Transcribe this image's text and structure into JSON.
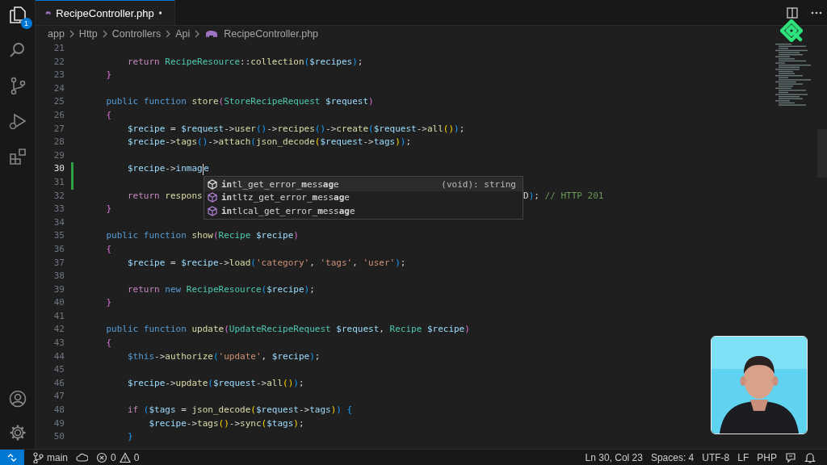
{
  "activity_bar": {
    "items": [
      {
        "selected": true,
        "badge": "1"
      },
      {
        "selected": false
      },
      {
        "selected": false
      },
      {
        "selected": false
      },
      {
        "selected": false
      }
    ]
  },
  "tabs": [
    {
      "label": "RecipeController.php",
      "selected": true,
      "modified": true
    }
  ],
  "breadcrumbs": [
    {
      "label": "app"
    },
    {
      "label": "Http"
    },
    {
      "label": "Controllers"
    },
    {
      "label": "Api"
    },
    {
      "label": "RecipeController.php"
    }
  ],
  "editor": {
    "lines": [
      {
        "number": "21",
        "current": false,
        "modified": false
      },
      {
        "number": "22",
        "current": false,
        "modified": false,
        "tokens": [
          {
            "kind": "kw",
            "text": "        return"
          },
          {
            "kind": "ty",
            "text": " RecipeResource"
          },
          {
            "kind": "pl",
            "text": "::"
          },
          {
            "kind": "fn",
            "text": "collection"
          },
          {
            "kind": "b3",
            "text": "("
          },
          {
            "kind": "var",
            "text": "$recipes"
          },
          {
            "kind": "b3",
            "text": ")"
          },
          {
            "kind": "pl",
            "text": ";"
          }
        ]
      },
      {
        "number": "23",
        "current": false,
        "modified": false,
        "tokens": [
          {
            "kind": "b2",
            "text": "    }"
          }
        ]
      },
      {
        "number": "24",
        "current": false,
        "modified": false
      },
      {
        "number": "25",
        "current": false,
        "modified": false,
        "tokens": [
          {
            "kind": "st",
            "text": "    public function"
          },
          {
            "kind": "fn",
            "text": " store"
          },
          {
            "kind": "b2",
            "text": "("
          },
          {
            "kind": "ty",
            "text": "StoreRecipeRequest"
          },
          {
            "kind": "var",
            "text": " $request"
          },
          {
            "kind": "b2",
            "text": ")"
          }
        ]
      },
      {
        "number": "26",
        "current": false,
        "modified": false,
        "tokens": [
          {
            "kind": "b2",
            "text": "    {"
          }
        ]
      },
      {
        "number": "27",
        "current": false,
        "modified": false,
        "tokens": [
          {
            "kind": "var",
            "text": "        $recipe"
          },
          {
            "kind": "pl",
            "text": " ="
          },
          {
            "kind": "var",
            "text": " $request"
          },
          {
            "kind": "pl",
            "text": "->"
          },
          {
            "kind": "fn",
            "text": "user"
          },
          {
            "kind": "b3",
            "text": "()"
          },
          {
            "kind": "pl",
            "text": "->"
          },
          {
            "kind": "fn",
            "text": "recipes"
          },
          {
            "kind": "b3",
            "text": "()"
          },
          {
            "kind": "pl",
            "text": "->"
          },
          {
            "kind": "fn",
            "text": "create"
          },
          {
            "kind": "b3",
            "text": "("
          },
          {
            "kind": "var",
            "text": "$request"
          },
          {
            "kind": "pl",
            "text": "->"
          },
          {
            "kind": "fn",
            "text": "all"
          },
          {
            "kind": "b1",
            "text": "()"
          },
          {
            "kind": "b3",
            "text": ")"
          },
          {
            "kind": "pl",
            "text": ";"
          }
        ]
      },
      {
        "number": "28",
        "current": false,
        "modified": false,
        "tokens": [
          {
            "kind": "var",
            "text": "        $recipe"
          },
          {
            "kind": "pl",
            "text": "->"
          },
          {
            "kind": "fn",
            "text": "tags"
          },
          {
            "kind": "b3",
            "text": "()"
          },
          {
            "kind": "pl",
            "text": "->"
          },
          {
            "kind": "fn",
            "text": "attach"
          },
          {
            "kind": "b3",
            "text": "("
          },
          {
            "kind": "fn",
            "text": "json_decode"
          },
          {
            "kind": "b1",
            "text": "("
          },
          {
            "kind": "var",
            "text": "$request"
          },
          {
            "kind": "pl",
            "text": "->"
          },
          {
            "kind": "var",
            "text": "tags"
          },
          {
            "kind": "b1",
            "text": ")"
          },
          {
            "kind": "b3",
            "text": ")"
          },
          {
            "kind": "pl",
            "text": ";"
          }
        ]
      },
      {
        "number": "29",
        "current": false,
        "modified": false
      },
      {
        "number": "30",
        "current": true,
        "modified": true,
        "tokens": [
          {
            "kind": "var",
            "text": "        $recipe"
          },
          {
            "kind": "pl",
            "text": "->"
          },
          {
            "kind": "var",
            "text": "inmag"
          },
          {
            "kind": "caret"
          },
          {
            "kind": "var",
            "text": "e"
          }
        ]
      },
      {
        "number": "31",
        "current": false,
        "modified": true
      },
      {
        "number": "32",
        "current": false,
        "modified": false,
        "tokens": [
          {
            "kind": "kw",
            "text": "        return"
          },
          {
            "kind": "fn",
            "text": " respons"
          },
          {
            "kind": "tail",
            "text": "D"
          },
          {
            "kind": "b3",
            "text": ")"
          },
          {
            "kind": "pl",
            "text": ";"
          },
          {
            "kind": "com",
            "text": " // HTTP 201"
          }
        ]
      },
      {
        "number": "33",
        "current": false,
        "modified": false,
        "tokens": [
          {
            "kind": "b2",
            "text": "    }"
          }
        ]
      },
      {
        "number": "34",
        "current": false,
        "modified": false
      },
      {
        "number": "35",
        "current": false,
        "modified": false,
        "tokens": [
          {
            "kind": "st",
            "text": "    public function"
          },
          {
            "kind": "fn",
            "text": " show"
          },
          {
            "kind": "b2",
            "text": "("
          },
          {
            "kind": "ty",
            "text": "Recipe"
          },
          {
            "kind": "var",
            "text": " $recipe"
          },
          {
            "kind": "b2",
            "text": ")"
          }
        ]
      },
      {
        "number": "36",
        "current": false,
        "modified": false,
        "tokens": [
          {
            "kind": "b2",
            "text": "    {"
          }
        ]
      },
      {
        "number": "37",
        "current": false,
        "modified": false,
        "tokens": [
          {
            "kind": "var",
            "text": "        $recipe"
          },
          {
            "kind": "pl",
            "text": " ="
          },
          {
            "kind": "var",
            "text": " $recipe"
          },
          {
            "kind": "pl",
            "text": "->"
          },
          {
            "kind": "fn",
            "text": "load"
          },
          {
            "kind": "b3",
            "text": "("
          },
          {
            "kind": "str",
            "text": "'category'"
          },
          {
            "kind": "pl",
            "text": ","
          },
          {
            "kind": "str",
            "text": " 'tags'"
          },
          {
            "kind": "pl",
            "text": ","
          },
          {
            "kind": "str",
            "text": " 'user'"
          },
          {
            "kind": "b3",
            "text": ")"
          },
          {
            "kind": "pl",
            "text": ";"
          }
        ]
      },
      {
        "number": "38",
        "current": false,
        "modified": false
      },
      {
        "number": "39",
        "current": false,
        "modified": false,
        "tokens": [
          {
            "kind": "kw",
            "text": "        return"
          },
          {
            "kind": "st",
            "text": " new"
          },
          {
            "kind": "ty",
            "text": " RecipeResource"
          },
          {
            "kind": "b3",
            "text": "("
          },
          {
            "kind": "var",
            "text": "$recipe"
          },
          {
            "kind": "b3",
            "text": ")"
          },
          {
            "kind": "pl",
            "text": ";"
          }
        ]
      },
      {
        "number": "40",
        "current": false,
        "modified": false,
        "tokens": [
          {
            "kind": "b2",
            "text": "    }"
          }
        ]
      },
      {
        "number": "41",
        "current": false,
        "modified": false
      },
      {
        "number": "42",
        "current": false,
        "modified": false,
        "tokens": [
          {
            "kind": "st",
            "text": "    public function"
          },
          {
            "kind": "fn",
            "text": " update"
          },
          {
            "kind": "b2",
            "text": "("
          },
          {
            "kind": "ty",
            "text": "UpdateRecipeRequest"
          },
          {
            "kind": "var",
            "text": " $request"
          },
          {
            "kind": "pl",
            "text": ","
          },
          {
            "kind": "ty",
            "text": " Recipe"
          },
          {
            "kind": "var",
            "text": " $recipe"
          },
          {
            "kind": "b2",
            "text": ")"
          }
        ]
      },
      {
        "number": "43",
        "current": false,
        "modified": false,
        "tokens": [
          {
            "kind": "b2",
            "text": "    {"
          }
        ]
      },
      {
        "number": "44",
        "current": false,
        "modified": false,
        "tokens": [
          {
            "kind": "st",
            "text": "        $this"
          },
          {
            "kind": "pl",
            "text": "->"
          },
          {
            "kind": "fn",
            "text": "authorize"
          },
          {
            "kind": "b3",
            "text": "("
          },
          {
            "kind": "str",
            "text": "'update'"
          },
          {
            "kind": "pl",
            "text": ","
          },
          {
            "kind": "var",
            "text": " $recipe"
          },
          {
            "kind": "b3",
            "text": ")"
          },
          {
            "kind": "pl",
            "text": ";"
          }
        ]
      },
      {
        "number": "45",
        "current": false,
        "modified": false
      },
      {
        "number": "46",
        "current": false,
        "modified": false,
        "tokens": [
          {
            "kind": "var",
            "text": "        $recipe"
          },
          {
            "kind": "pl",
            "text": "->"
          },
          {
            "kind": "fn",
            "text": "update"
          },
          {
            "kind": "b3",
            "text": "("
          },
          {
            "kind": "var",
            "text": "$request"
          },
          {
            "kind": "pl",
            "text": "->"
          },
          {
            "kind": "fn",
            "text": "all"
          },
          {
            "kind": "b1",
            "text": "()"
          },
          {
            "kind": "b3",
            "text": ")"
          },
          {
            "kind": "pl",
            "text": ";"
          }
        ]
      },
      {
        "number": "47",
        "current": false,
        "modified": false
      },
      {
        "number": "48",
        "current": false,
        "modified": false,
        "tokens": [
          {
            "kind": "kw",
            "text": "        if"
          },
          {
            "kind": "b3",
            "text": " ("
          },
          {
            "kind": "var",
            "text": "$tags"
          },
          {
            "kind": "pl",
            "text": " ="
          },
          {
            "kind": "fn",
            "text": " json_decode"
          },
          {
            "kind": "b1",
            "text": "("
          },
          {
            "kind": "var",
            "text": "$request"
          },
          {
            "kind": "pl",
            "text": "->"
          },
          {
            "kind": "var",
            "text": "tags"
          },
          {
            "kind": "b1",
            "text": ")"
          },
          {
            "kind": "b3",
            "text": ")"
          },
          {
            "kind": "b3",
            "text": " {"
          }
        ]
      },
      {
        "number": "49",
        "current": false,
        "modified": false,
        "tokens": [
          {
            "kind": "var",
            "text": "            $recipe"
          },
          {
            "kind": "pl",
            "text": "->"
          },
          {
            "kind": "fn",
            "text": "tags"
          },
          {
            "kind": "b1",
            "text": "()"
          },
          {
            "kind": "pl",
            "text": "->"
          },
          {
            "kind": "fn",
            "text": "sync"
          },
          {
            "kind": "b1",
            "text": "("
          },
          {
            "kind": "var",
            "text": "$tags"
          },
          {
            "kind": "b1",
            "text": ")"
          },
          {
            "kind": "pl",
            "text": ";"
          }
        ]
      },
      {
        "number": "50",
        "current": false,
        "modified": false,
        "tokens": [
          {
            "kind": "b3",
            "text": "        }"
          }
        ]
      }
    ]
  },
  "suggestions": [
    {
      "label": "**in**tl_get_error_**m**ess**ag**e",
      "detail": "(void): string",
      "selected": true
    },
    {
      "label": "**in**tltz_get_error_**m**ess**ag**e",
      "selected": false
    },
    {
      "label": "**in**tlcal_get_error_**m**ess**ag**e",
      "selected": false
    }
  ],
  "status_bar": {
    "branch": "main",
    "errors": "0",
    "warnings": "0",
    "right": [
      "Ln 30, Col 23",
      "Spaces: 4",
      "UTF-8",
      "LF",
      "PHP"
    ]
  }
}
